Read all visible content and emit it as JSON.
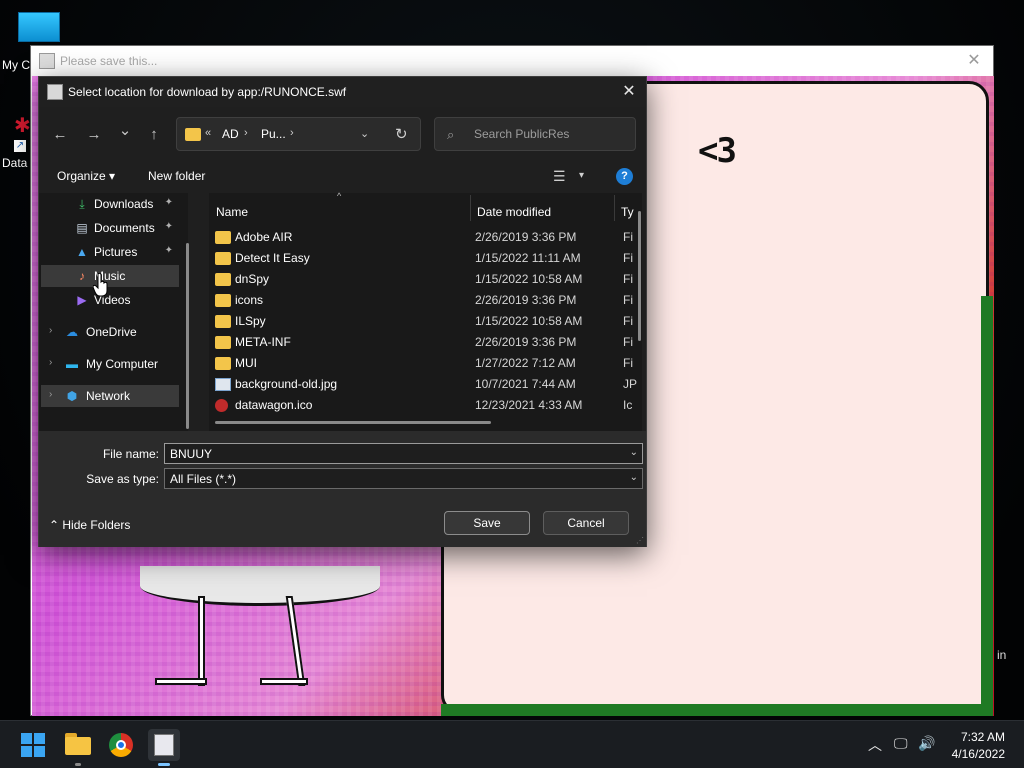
{
  "desktop": {
    "icons": [
      {
        "label": "My C"
      },
      {
        "label": "Data"
      }
    ]
  },
  "background_window": {
    "title": "Please save this...",
    "close_glyph": "✕",
    "game_text": "<3",
    "side_label": "in"
  },
  "dialog": {
    "title": "Select location for download by app:/RUNONCE.swf",
    "close_glyph": "✕",
    "nav": {
      "back_glyph": "←",
      "forward_glyph": "→",
      "recent_glyph": "⌄",
      "up_glyph": "↑"
    },
    "address": {
      "overflow": "«",
      "crumbs": [
        "AD",
        "Pu..."
      ],
      "chevron": "›",
      "dropdown_glyph": "⌄",
      "refresh_glyph": "↻"
    },
    "search": {
      "placeholder": "Search PublicRes",
      "icon_glyph": "⌕"
    },
    "toolbar": {
      "organize": "Organize ▾",
      "new_folder": "New folder",
      "view_glyph": "☰",
      "view_dd_glyph": "▾",
      "help_glyph": "?"
    },
    "nav_pane": {
      "items": [
        {
          "label": "Downloads",
          "icon": "download-icon",
          "pinned": true
        },
        {
          "label": "Documents",
          "icon": "documents-icon",
          "pinned": true
        },
        {
          "label": "Pictures",
          "icon": "pictures-icon",
          "pinned": true
        },
        {
          "label": "Music",
          "icon": "music-icon",
          "pinned": false,
          "selected": true
        },
        {
          "label": "Videos",
          "icon": "videos-icon",
          "pinned": false
        },
        {
          "label": "OneDrive",
          "icon": "cloud-icon",
          "expandable": true
        },
        {
          "label": "My Computer",
          "icon": "computer-icon",
          "expandable": true
        },
        {
          "label": "Network",
          "icon": "network-icon",
          "expandable": true,
          "selected": true
        }
      ],
      "pin_glyph": "📌",
      "expand_glyph": "›"
    },
    "columns": {
      "name": "Name",
      "date_modified": "Date modified",
      "type": "Ty",
      "sort_glyph": "^"
    },
    "files": [
      {
        "name": "Adobe AIR",
        "date": "2/26/2019 3:36 PM",
        "type": "Fi",
        "kind": "folder"
      },
      {
        "name": "Detect It Easy",
        "date": "1/15/2022 11:11 AM",
        "type": "Fi",
        "kind": "folder"
      },
      {
        "name": "dnSpy",
        "date": "1/15/2022 10:58 AM",
        "type": "Fi",
        "kind": "folder"
      },
      {
        "name": "icons",
        "date": "2/26/2019 3:36 PM",
        "type": "Fi",
        "kind": "folder"
      },
      {
        "name": "ILSpy",
        "date": "1/15/2022 10:58 AM",
        "type": "Fi",
        "kind": "folder"
      },
      {
        "name": "META-INF",
        "date": "2/26/2019 3:36 PM",
        "type": "Fi",
        "kind": "folder"
      },
      {
        "name": "MUI",
        "date": "1/27/2022 7:12 AM",
        "type": "Fi",
        "kind": "folder"
      },
      {
        "name": "background-old.jpg",
        "date": "10/7/2021 7:44 AM",
        "type": "JP",
        "kind": "image"
      },
      {
        "name": "datawagon.ico",
        "date": "12/23/2021 4:33 AM",
        "type": "Ic",
        "kind": "icon"
      }
    ],
    "file_name": {
      "label": "File name:",
      "value": "BNUUY"
    },
    "save_as_type": {
      "label": "Save as type:",
      "value": "All Files (*.*)"
    },
    "dropdown_glyph": "⌄",
    "hide_folders": "⌃  Hide Folders",
    "save_label": "Save",
    "cancel_label": "Cancel"
  },
  "taskbar": {
    "tray_chevron": "︿",
    "network_glyph": "🖵",
    "volume_glyph": "🔊",
    "time": "7:32 AM",
    "date": "4/16/2022"
  },
  "colors": {
    "dialog_bg": "#1f1f1f",
    "accent": "#1e7ed6",
    "folder": "#f3c54a",
    "taskbar": "#1a1d21"
  }
}
